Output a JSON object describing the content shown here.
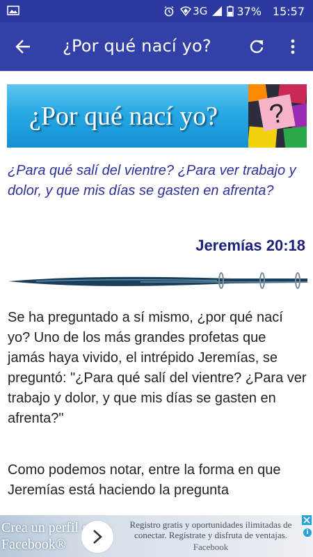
{
  "status_bar": {
    "network": "3G",
    "battery": "37%",
    "time": "15:57",
    "icons": [
      "image-icon",
      "alarm-icon",
      "wifi-icon",
      "signal-icon",
      "battery-icon"
    ]
  },
  "app_bar": {
    "title": "¿Por qué nací yo?",
    "icons": [
      "back-arrow-icon",
      "refresh-icon",
      "more-vert-icon"
    ],
    "color": "#3340a8"
  },
  "banner": {
    "title": "¿Por qué nací yo?"
  },
  "verse": {
    "text": "¿Para qué salí del vientre? ¿Para ver trabajo y dolor, y que mis días se gasten en afrenta?",
    "reference": "Jeremías 20:18"
  },
  "body": {
    "paragraph_1": "Se ha preguntado a sí mismo, ¿por qué nací yo? Uno de los más grandes profetas que jamás haya vivido, el intrépido Jeremías, se preguntó: \"¿Para qué salí del vientre? ¿Para ver trabajo y dolor, y que mis días se gasten en afrenta?\"",
    "paragraph_2": "Como podemos notar, entre la forma en que Jeremías está haciendo la pregunta"
  },
  "ad": {
    "headline": "Crea un perfil en Facebook®",
    "description": "Registro gratis y oportunidades ilimitadas de conectar. Regístrate y disfruta de ventajas.",
    "brand": "Facebook",
    "accent": "#28a1d8"
  }
}
